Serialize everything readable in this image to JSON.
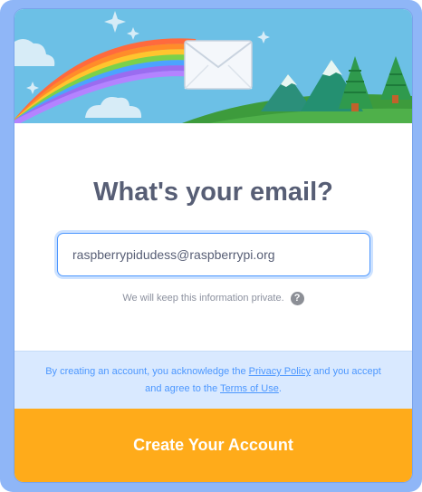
{
  "heading": "What's your email?",
  "email_input": {
    "value": "raspberrypidudess@raspberrypi.org",
    "placeholder": ""
  },
  "privacy_note": "We will keep this information private.",
  "help_icon_glyph": "?",
  "legal": {
    "prefix": "By creating an account, you acknowledge the ",
    "privacy_link": "Privacy Policy",
    "middle": " and you accept and agree to the ",
    "terms_link": "Terms of Use",
    "suffix": "."
  },
  "create_button_label": "Create Your Account",
  "colors": {
    "sky": "#6cc0e6",
    "input_border": "#4c97ff",
    "legal_bg": "#d9e9ff",
    "button": "#ffab1a",
    "heading_text": "#575e75"
  },
  "icons": [
    "envelope-icon",
    "help-icon",
    "sparkle-icon",
    "cloud-icon",
    "tree-icon",
    "rainbow-icon"
  ]
}
